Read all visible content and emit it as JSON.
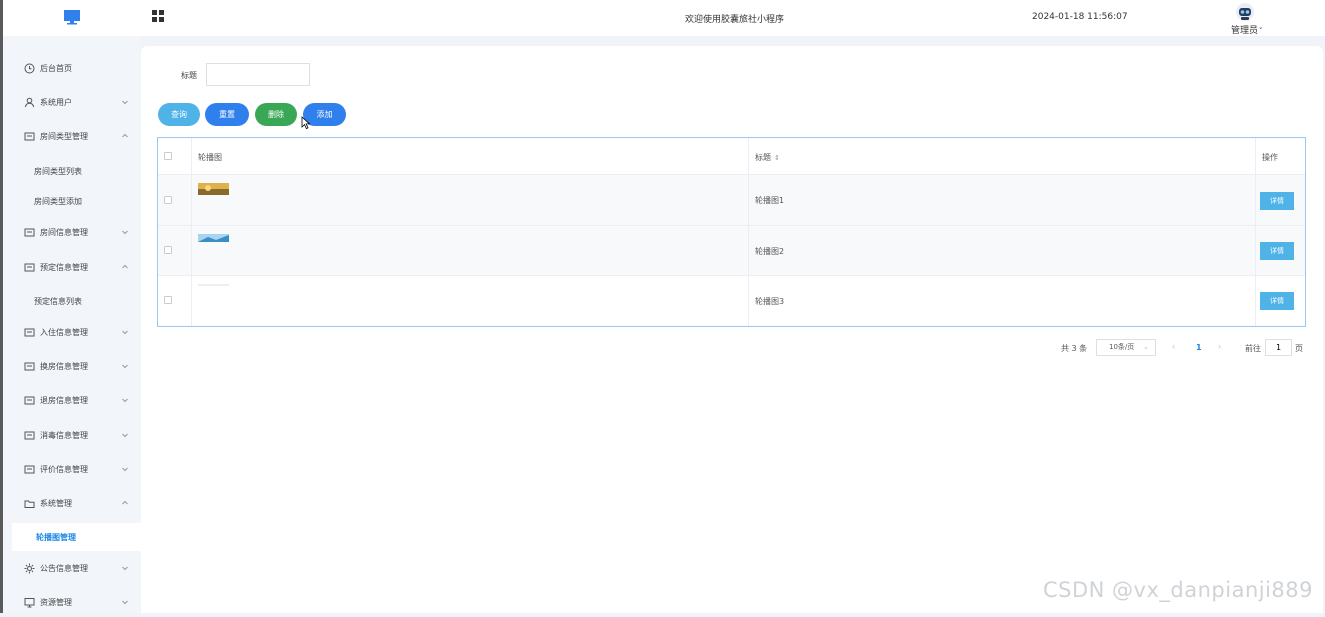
{
  "header": {
    "title": "欢迎使用胶囊旅社小程序",
    "datetime": "2024-01-18 11:56:07",
    "user_name": "管理员",
    "user_chevron": "˅"
  },
  "sidebar": {
    "items": [
      {
        "label": "后台首页"
      },
      {
        "label": "系统用户"
      },
      {
        "label": "房间类型管理"
      },
      {
        "label": "房间类型列表"
      },
      {
        "label": "房间类型添加"
      },
      {
        "label": "房间信息管理"
      },
      {
        "label": "预定信息管理"
      },
      {
        "label": "预定信息列表"
      },
      {
        "label": "入住信息管理"
      },
      {
        "label": "换房信息管理"
      },
      {
        "label": "退房信息管理"
      },
      {
        "label": "消毒信息管理"
      },
      {
        "label": "评价信息管理"
      },
      {
        "label": "系统管理"
      },
      {
        "label": "轮播图管理"
      },
      {
        "label": "公告信息管理"
      },
      {
        "label": "资源管理"
      }
    ]
  },
  "search": {
    "label": "标题",
    "value": "",
    "buttons": {
      "search": "查询",
      "reset": "重置",
      "delete": "删除",
      "add": "添加"
    }
  },
  "table": {
    "headers": {
      "image": "轮播图",
      "title": "标题",
      "actions": "操作"
    },
    "sort_icon": "⇕",
    "rows": [
      {
        "title": "轮播图1",
        "action": "详情"
      },
      {
        "title": "轮播图2",
        "action": "详情"
      },
      {
        "title": "轮播图3",
        "action": "详情"
      }
    ]
  },
  "pagination": {
    "total": "共 3 条",
    "page_size": "10条/页",
    "current": "1",
    "goto_label": "前往",
    "goto_value": "1",
    "page_suffix": "页",
    "prev": "‹",
    "next": "›",
    "chevron": "⌄"
  },
  "watermark": "CSDN @vx_danpianji889",
  "colors": {
    "primary": "#2f80ed",
    "info": "#4fb3e8",
    "success": "#3aa757",
    "active_text": "#1e88e5"
  }
}
